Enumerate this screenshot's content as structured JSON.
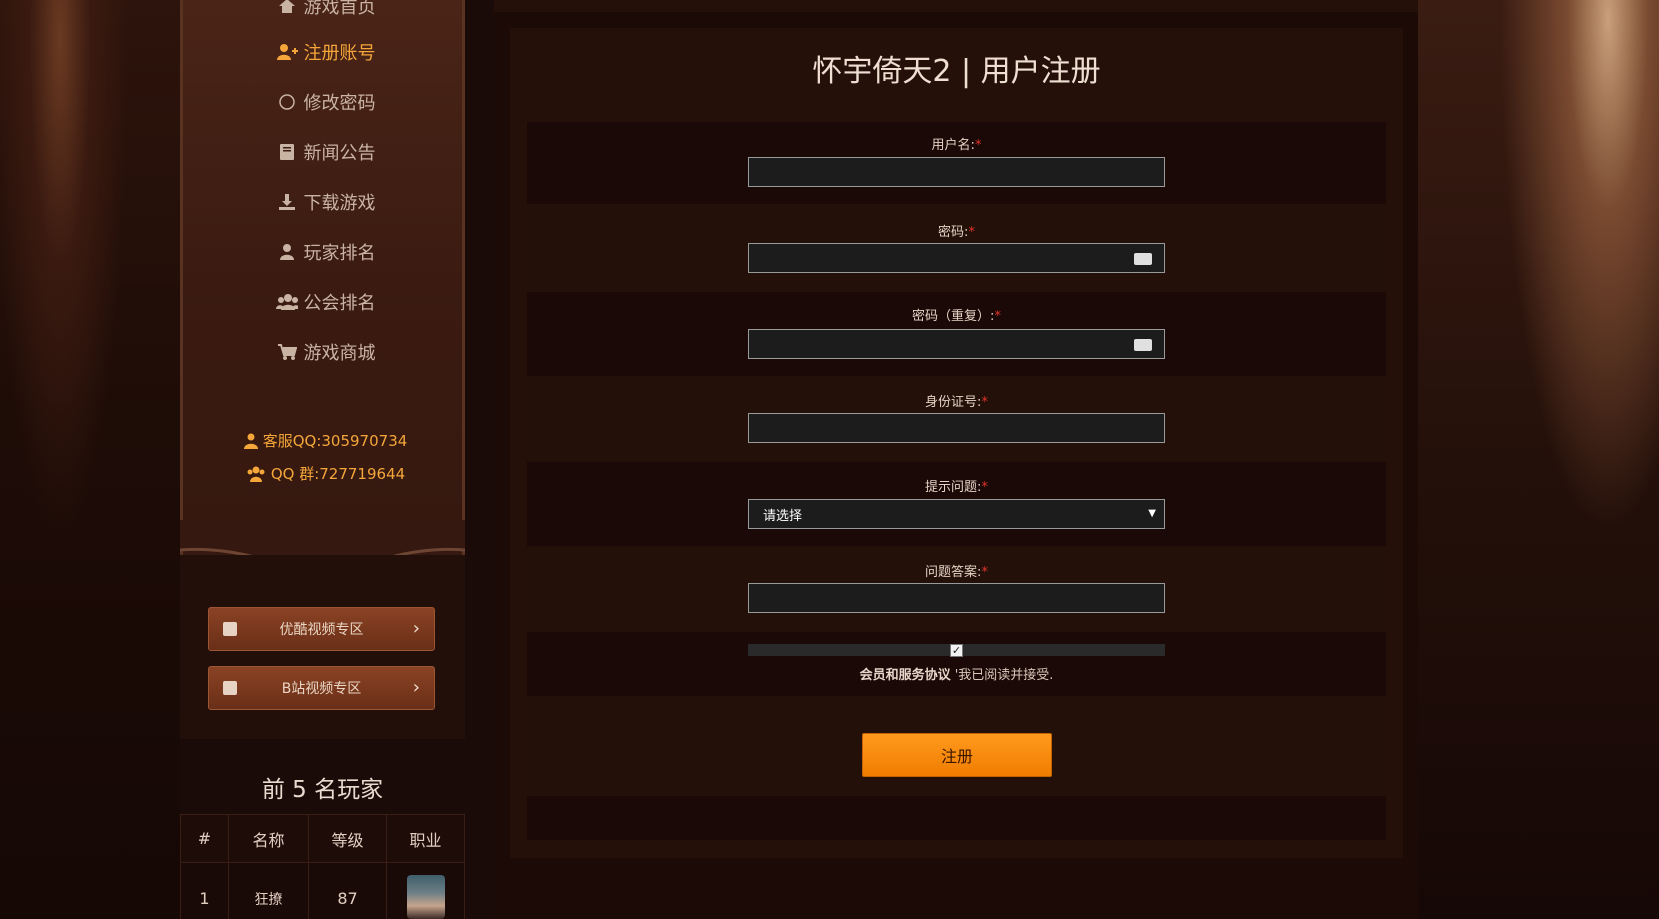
{
  "sidebar": {
    "items": [
      {
        "label": "游戏首页",
        "icon": "home-icon"
      },
      {
        "label": "注册账号",
        "icon": "user-plus-icon",
        "active": true
      },
      {
        "label": "修改密码",
        "icon": "circle-icon"
      },
      {
        "label": "新闻公告",
        "icon": "book-icon"
      },
      {
        "label": "下载游戏",
        "icon": "download-icon"
      },
      {
        "label": "玩家排名",
        "icon": "user-icon"
      },
      {
        "label": "公会排名",
        "icon": "users-icon"
      },
      {
        "label": "游戏商城",
        "icon": "cart-icon"
      }
    ],
    "contact_qq": "客服QQ:305970734",
    "contact_group": "QQ 群:727719644",
    "buttons": [
      {
        "label": "优酷视频专区"
      },
      {
        "label": "B站视频专区"
      }
    ]
  },
  "top5": {
    "title": "前 5 名玩家",
    "columns": [
      "#",
      "名称",
      "等级",
      "职业"
    ],
    "rows": [
      {
        "rank": "1",
        "name": "狂撩",
        "level": "87"
      }
    ]
  },
  "form": {
    "title": "怀宇倚天2 | 用户注册",
    "username_label": "用户名:",
    "password_label": "密码:",
    "password_repeat_label": "密码（重复）:",
    "id_label": "身份证号:",
    "question_label": "提示问题:",
    "question_selected": "请选择",
    "answer_label": "问题答案:",
    "required_mark": "*",
    "agree_bold": "会员和服务协议",
    "agree_rest": " '我已阅读并接受.",
    "submit_label": "注册"
  },
  "colors": {
    "accent": "#f4a63a",
    "submit": "#f07d00",
    "required": "#e2342a"
  }
}
